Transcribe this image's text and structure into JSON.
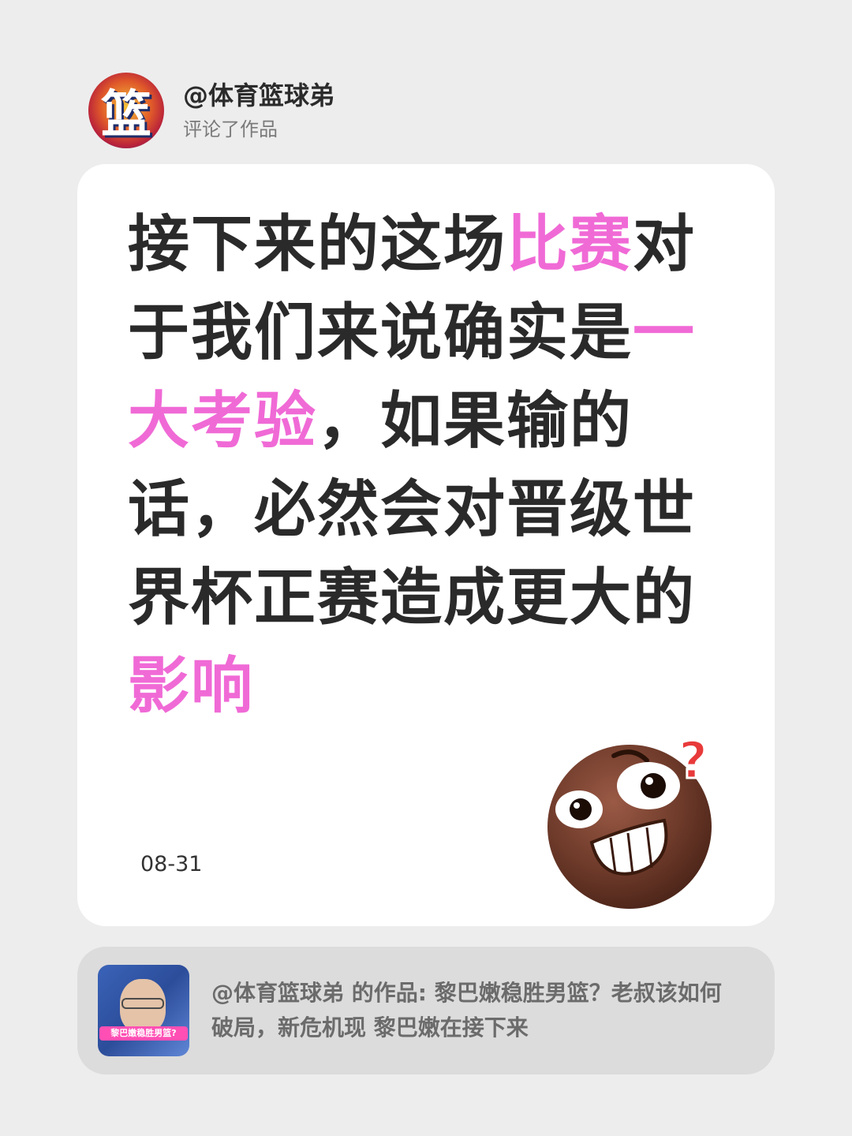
{
  "header": {
    "avatar_text": "篮",
    "username": "@体育篮球弟",
    "action": "评论了作品"
  },
  "comment": {
    "segments": [
      {
        "text": "接下来的这场",
        "highlight": false
      },
      {
        "text": "比赛",
        "highlight": true
      },
      {
        "text": "对于我们来说确实是",
        "highlight": false
      },
      {
        "text": "一大考验",
        "highlight": true
      },
      {
        "text": "，如果输的话，必然会对晋级世界杯正赛造成更大的",
        "highlight": false
      },
      {
        "text": "影响",
        "highlight": true
      }
    ],
    "date": "08-31"
  },
  "emoji": {
    "name": "nervous-smile-question-emoji",
    "question_mark": "?"
  },
  "reference": {
    "thumb_caption": "黎巴嫩稳胜男篮?",
    "text": "@体育篮球弟 的作品: 黎巴嫩稳胜男篮？老叔该如何破局，新危机现 黎巴嫩在接下来"
  },
  "colors": {
    "background": "#ededed",
    "card": "#ffffff",
    "highlight": "#f06ad6",
    "text": "#2a2a2a",
    "reference_bg": "#dcdcdc"
  }
}
